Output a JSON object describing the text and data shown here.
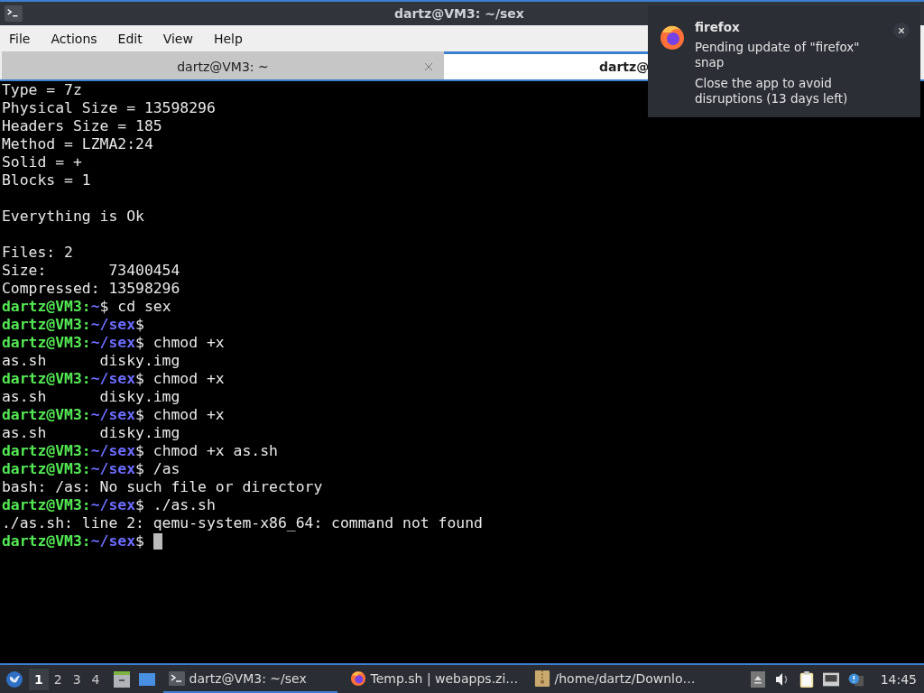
{
  "window": {
    "title": "dartz@VM3: ~/sex"
  },
  "menu": [
    "File",
    "Actions",
    "Edit",
    "View",
    "Help"
  ],
  "tabs": [
    {
      "label": "dartz@VM3: ~",
      "selected": false
    },
    {
      "label": "dartz@",
      "selected": true
    }
  ],
  "terminal": {
    "cursor": true,
    "lines": [
      {
        "kind": "output",
        "text": "Type = 7z"
      },
      {
        "kind": "output",
        "text": "Physical Size = 13598296"
      },
      {
        "kind": "output",
        "text": "Headers Size = 185"
      },
      {
        "kind": "output",
        "text": "Method = LZMA2:24"
      },
      {
        "kind": "output",
        "text": "Solid = +"
      },
      {
        "kind": "output",
        "text": "Blocks = 1"
      },
      {
        "kind": "blank"
      },
      {
        "kind": "output",
        "text": "Everything is Ok"
      },
      {
        "kind": "blank"
      },
      {
        "kind": "output",
        "text": "Files: 2"
      },
      {
        "kind": "output",
        "text": "Size:       73400454"
      },
      {
        "kind": "output",
        "text": "Compressed: 13598296"
      },
      {
        "kind": "prompt",
        "user": "dartz@VM3:",
        "path": "~",
        "command": "$ cd sex"
      },
      {
        "kind": "prompt",
        "user": "dartz@VM3:",
        "path": "~/sex",
        "command": "$"
      },
      {
        "kind": "prompt",
        "user": "dartz@VM3:",
        "path": "~/sex",
        "command": "$ chmod +x"
      },
      {
        "kind": "output",
        "text": "as.sh      disky.img"
      },
      {
        "kind": "prompt",
        "user": "dartz@VM3:",
        "path": "~/sex",
        "command": "$ chmod +x"
      },
      {
        "kind": "output",
        "text": "as.sh      disky.img"
      },
      {
        "kind": "prompt",
        "user": "dartz@VM3:",
        "path": "~/sex",
        "command": "$ chmod +x"
      },
      {
        "kind": "output",
        "text": "as.sh      disky.img"
      },
      {
        "kind": "prompt",
        "user": "dartz@VM3:",
        "path": "~/sex",
        "command": "$ chmod +x as.sh"
      },
      {
        "kind": "prompt",
        "user": "dartz@VM3:",
        "path": "~/sex",
        "command": "$ /as"
      },
      {
        "kind": "output",
        "text": "bash: /as: No such file or directory"
      },
      {
        "kind": "prompt",
        "user": "dartz@VM3:",
        "path": "~/sex",
        "command": "$ ./as.sh"
      },
      {
        "kind": "output",
        "text": "./as.sh: line 2: qemu-system-x86_64: command not found"
      },
      {
        "kind": "prompt",
        "user": "dartz@VM3:",
        "path": "~/sex",
        "command": "$"
      }
    ]
  },
  "notification": {
    "app": "firefox",
    "message": "Pending update of \"firefox\" snap",
    "detail": "Close the app to avoid disruptions (13 days left)"
  },
  "taskbar": {
    "workspaces": [
      {
        "label": "1",
        "selected": true
      },
      {
        "label": "2",
        "selected": false
      },
      {
        "label": "3",
        "selected": false
      },
      {
        "label": "4",
        "selected": false
      }
    ],
    "tasks": [
      {
        "kind": "terminal",
        "label": "dartz@VM3: ~/sex",
        "selected": true
      },
      {
        "kind": "browser",
        "label": "Temp.sh | webapps.zi…",
        "selected": false
      },
      {
        "kind": "archive",
        "label": "/home/dartz/Downlo…",
        "selected": false
      }
    ],
    "clock": "14:45"
  }
}
